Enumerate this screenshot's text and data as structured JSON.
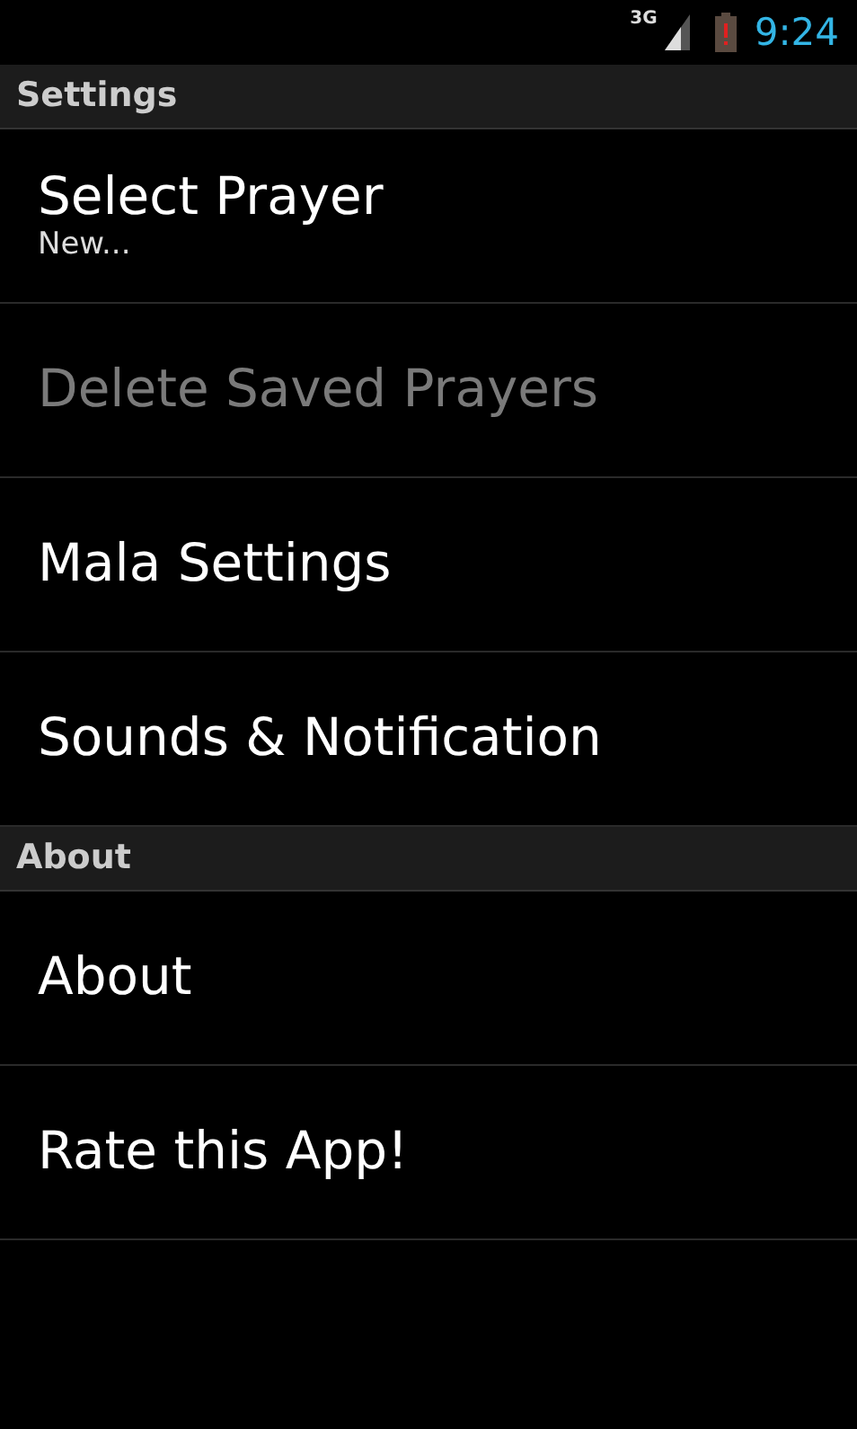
{
  "status_bar": {
    "network": "3G",
    "time": "9:24"
  },
  "sections": [
    {
      "title": "Settings",
      "items": [
        {
          "title": "Select Prayer",
          "summary": "New...",
          "disabled": false
        },
        {
          "title": "Delete Saved Prayers",
          "disabled": true
        },
        {
          "title": "Mala Settings",
          "disabled": false
        },
        {
          "title": "Sounds & Notification",
          "disabled": false
        }
      ]
    },
    {
      "title": "About",
      "items": [
        {
          "title": "About",
          "disabled": false
        },
        {
          "title": "Rate this App!",
          "disabled": false
        }
      ]
    }
  ]
}
